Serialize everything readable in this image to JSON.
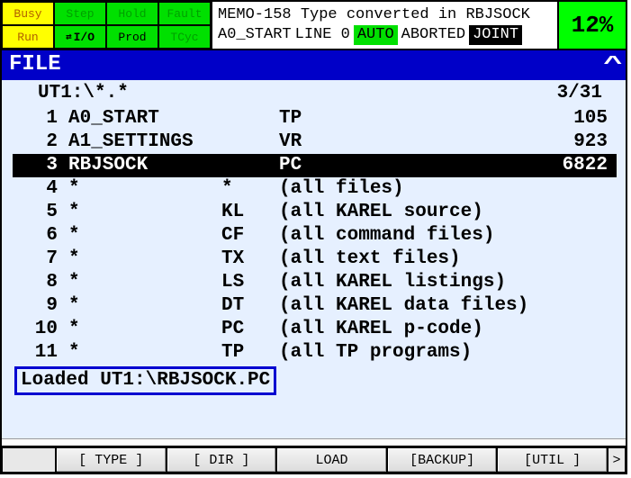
{
  "status": {
    "busy": "Busy",
    "step": "Step",
    "hold": "Hold",
    "fault": "Fault",
    "run": "Run",
    "io": "I/O",
    "prod": "Prod",
    "tcyc": "TCyc"
  },
  "message": {
    "line1": "MEMO-158 Type converted in RBJSOCK",
    "prog": "A0_START",
    "line": "LINE 0",
    "auto": "AUTO",
    "state": "ABORTED",
    "joint": "JOINT"
  },
  "percent": "12%",
  "title": "FILE",
  "path": "UT1:\\*.*",
  "counter": "3/31",
  "rows": [
    {
      "idx": "1",
      "name": "A0_START",
      "ext": "",
      "desc": "TP",
      "size": "105",
      "sel": false
    },
    {
      "idx": "2",
      "name": "A1_SETTINGS",
      "ext": "",
      "desc": "VR",
      "size": "923",
      "sel": false
    },
    {
      "idx": "3",
      "name": "RBJSOCK",
      "ext": "",
      "desc": "PC",
      "size": "6822",
      "sel": true
    },
    {
      "idx": "4",
      "name": "*",
      "ext": "*",
      "desc": "(all files)",
      "size": "",
      "sel": false
    },
    {
      "idx": "5",
      "name": "*",
      "ext": "KL",
      "desc": "(all KAREL source)",
      "size": "",
      "sel": false
    },
    {
      "idx": "6",
      "name": "*",
      "ext": "CF",
      "desc": "(all command files)",
      "size": "",
      "sel": false
    },
    {
      "idx": "7",
      "name": "*",
      "ext": "TX",
      "desc": "(all text files)",
      "size": "",
      "sel": false
    },
    {
      "idx": "8",
      "name": "*",
      "ext": "LS",
      "desc": "(all KAREL listings)",
      "size": "",
      "sel": false
    },
    {
      "idx": "9",
      "name": "*",
      "ext": "DT",
      "desc": "(all KAREL data files)",
      "size": "",
      "sel": false
    },
    {
      "idx": "10",
      "name": "*",
      "ext": "PC",
      "desc": "(all KAREL p-code)",
      "size": "",
      "sel": false
    },
    {
      "idx": "11",
      "name": "*",
      "ext": "TP",
      "desc": "(all TP programs)",
      "size": "",
      "sel": false
    }
  ],
  "loaded": "Loaded UT1:\\RBJSOCK.PC",
  "footer": {
    "f1": "[ TYPE ]",
    "f2": "[ DIR ]",
    "f3": "LOAD",
    "f4": "[BACKUP]",
    "f5": "[UTIL ]"
  }
}
